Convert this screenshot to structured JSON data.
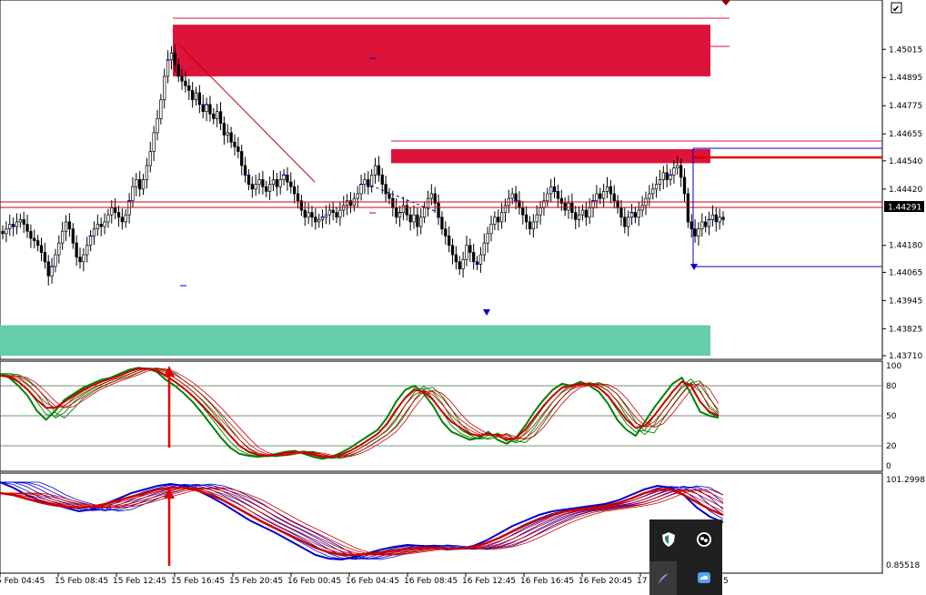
{
  "chart_data": [
    {
      "type": "candlestick",
      "panel": "price",
      "y_ticks": [
        "1.45015",
        "1.44895",
        "1.44775",
        "1.44655",
        "1.44540",
        "1.44420",
        "1.44180",
        "1.44065",
        "1.43945",
        "1.43825",
        "1.43710"
      ],
      "current_price": "1.44291",
      "ylim": [
        1.4371,
        1.4514
      ],
      "zones": [
        {
          "color": "#dc143c",
          "low": 1.449,
          "high": 1.4512
        },
        {
          "color": "#dc143c",
          "low": 1.4453,
          "high": 1.4459
        },
        {
          "color": "#66cdaa",
          "low": 1.4371,
          "high": 1.4384
        }
      ],
      "closes": [
        1.4423,
        1.4425,
        1.4427,
        1.4426,
        1.4428,
        1.4429,
        1.4427,
        1.4424,
        1.4421,
        1.442,
        1.4418,
        1.4415,
        1.4411,
        1.4405,
        1.4409,
        1.4414,
        1.4419,
        1.4424,
        1.4428,
        1.4425,
        1.4419,
        1.4413,
        1.4411,
        1.4414,
        1.4418,
        1.4422,
        1.4425,
        1.4427,
        1.4426,
        1.4428,
        1.4431,
        1.4434,
        1.4432,
        1.443,
        1.4428,
        1.4431,
        1.4437,
        1.4443,
        1.4446,
        1.4442,
        1.4446,
        1.4452,
        1.4458,
        1.4466,
        1.4472,
        1.448,
        1.449,
        1.4497,
        1.45,
        1.4495,
        1.449,
        1.4488,
        1.4486,
        1.4484,
        1.448,
        1.4483,
        1.4478,
        1.4475,
        1.4478,
        1.4474,
        1.4472,
        1.4475,
        1.447,
        1.4465,
        1.4466,
        1.4462,
        1.446,
        1.4458,
        1.4452,
        1.4448,
        1.4444,
        1.4442,
        1.4444,
        1.4446,
        1.4443,
        1.4441,
        1.4444,
        1.4446,
        1.4443,
        1.4446,
        1.4448,
        1.4445,
        1.4443,
        1.444,
        1.4437,
        1.4433,
        1.443,
        1.4432,
        1.443,
        1.4428,
        1.4429,
        1.443,
        1.4431,
        1.4433,
        1.4432,
        1.443,
        1.4433,
        1.4435,
        1.4437,
        1.4435,
        1.4438,
        1.444,
        1.4444,
        1.4446,
        1.4443,
        1.4448,
        1.4452,
        1.4448,
        1.4444,
        1.444,
        1.4438,
        1.4434,
        1.443,
        1.4432,
        1.4435,
        1.4431,
        1.4428,
        1.4431,
        1.4426,
        1.443,
        1.4434,
        1.4438,
        1.444,
        1.4436,
        1.443,
        1.4425,
        1.4422,
        1.4418,
        1.4414,
        1.4411,
        1.4408,
        1.4412,
        1.4418,
        1.4415,
        1.4411,
        1.441,
        1.4414,
        1.4419,
        1.4423,
        1.4427,
        1.443,
        1.4428,
        1.4432,
        1.4435,
        1.4438,
        1.444,
        1.4437,
        1.4434,
        1.4431,
        1.4428,
        1.4425,
        1.4428,
        1.4431,
        1.4434,
        1.4437,
        1.444,
        1.4443,
        1.4441,
        1.4438,
        1.4436,
        1.4433,
        1.4436,
        1.4432,
        1.4429,
        1.4431,
        1.4433,
        1.443,
        1.4434,
        1.4437,
        1.444,
        1.4438,
        1.4441,
        1.4443,
        1.444,
        1.4437,
        1.4434,
        1.443,
        1.4426,
        1.443,
        1.4432,
        1.443,
        1.4433,
        1.4435,
        1.4438,
        1.444,
        1.4442,
        1.4444,
        1.4446,
        1.4449,
        1.4446,
        1.4448,
        1.4451,
        1.4452,
        1.4447,
        1.444,
        1.4428,
        1.4425,
        1.4422,
        1.4425,
        1.4428,
        1.4426,
        1.4429,
        1.4431,
        1.4428,
        1.443,
        1.4429
      ],
      "x_labels": [
        "5 Feb 04:45",
        "15 Feb 08:45",
        "15 Feb 12:45",
        "15 Feb 16:45",
        "15 Feb 20:45",
        "16 Feb 00:45",
        "16 Feb 04:45",
        "16 Feb 08:45",
        "16 Feb 12:45",
        "16 Feb 16:45",
        "16 Feb 20:45",
        "17 Feb"
      ],
      "partial_label": "5"
    },
    {
      "type": "line",
      "panel": "stochastic",
      "y_ticks": [
        "100",
        "80",
        "50",
        "20",
        "0"
      ],
      "levels": [
        80,
        50,
        20
      ],
      "ylim": [
        0,
        100
      ],
      "series_colors": [
        "#008000",
        "#cc0000"
      ],
      "green": [
        92,
        88,
        80,
        70,
        55,
        46,
        55,
        66,
        72,
        78,
        82,
        86,
        88,
        92,
        96,
        98,
        97,
        94,
        86,
        80,
        72,
        63,
        52,
        40,
        28,
        18,
        12,
        10,
        9,
        10,
        12,
        14,
        15,
        12,
        9,
        7,
        9,
        13,
        18,
        24,
        30,
        36,
        48,
        64,
        76,
        80,
        72,
        60,
        44,
        34,
        30,
        26,
        28,
        34,
        26,
        22,
        28,
        40,
        54,
        66,
        76,
        82,
        80,
        84,
        80,
        74,
        62,
        46,
        36,
        30,
        44,
        58,
        70,
        82,
        88,
        72,
        54,
        50,
        48
      ],
      "red": [
        90,
        89,
        84,
        76,
        66,
        58,
        58,
        64,
        70,
        76,
        80,
        84,
        87,
        90,
        94,
        97,
        97,
        95,
        90,
        84,
        77,
        69,
        60,
        50,
        40,
        30,
        20,
        14,
        11,
        10,
        11,
        13,
        14,
        13,
        11,
        9,
        9,
        11,
        15,
        20,
        26,
        32,
        42,
        56,
        68,
        76,
        74,
        66,
        54,
        44,
        38,
        32,
        30,
        32,
        30,
        26,
        28,
        36,
        48,
        60,
        70,
        78,
        80,
        82,
        82,
        78,
        70,
        58,
        46,
        38,
        40,
        50,
        62,
        74,
        84,
        80,
        64,
        54,
        50
      ]
    },
    {
      "type": "line",
      "panel": "oscillator",
      "y_ticks": [
        "101.29981",
        "0.85518"
      ],
      "ylim": [
        0,
        100
      ],
      "series_colors": [
        "#0000cc",
        "#cc0000"
      ],
      "blue": [
        94,
        88,
        80,
        74,
        70,
        66,
        62,
        64,
        70,
        76,
        82,
        86,
        90,
        92,
        90,
        85,
        78,
        70,
        61,
        52,
        45,
        38,
        30,
        22,
        14,
        10,
        9,
        12,
        16,
        20,
        23,
        25,
        24,
        22,
        20,
        21,
        24,
        30,
        38,
        46,
        52,
        58,
        62,
        64,
        66,
        68,
        70,
        74,
        80,
        86,
        90,
        88,
        80,
        66,
        56,
        50
      ],
      "red": [
        82,
        80,
        76,
        72,
        69,
        67,
        66,
        67,
        70,
        74,
        78,
        82,
        86,
        88,
        88,
        85,
        80,
        74,
        66,
        58,
        50,
        43,
        36,
        29,
        22,
        17,
        14,
        14,
        15,
        17,
        19,
        21,
        22,
        22,
        21,
        21,
        23,
        27,
        33,
        40,
        47,
        53,
        58,
        62,
        64,
        66,
        68,
        71,
        76,
        82,
        86,
        86,
        80,
        72,
        64,
        58
      ]
    }
  ],
  "toolbar": {
    "checkbox_symbol": "✔"
  },
  "tray": {
    "icons": [
      "shield-icon",
      "logo-icon",
      "feather-icon",
      "cloud-icon"
    ]
  }
}
